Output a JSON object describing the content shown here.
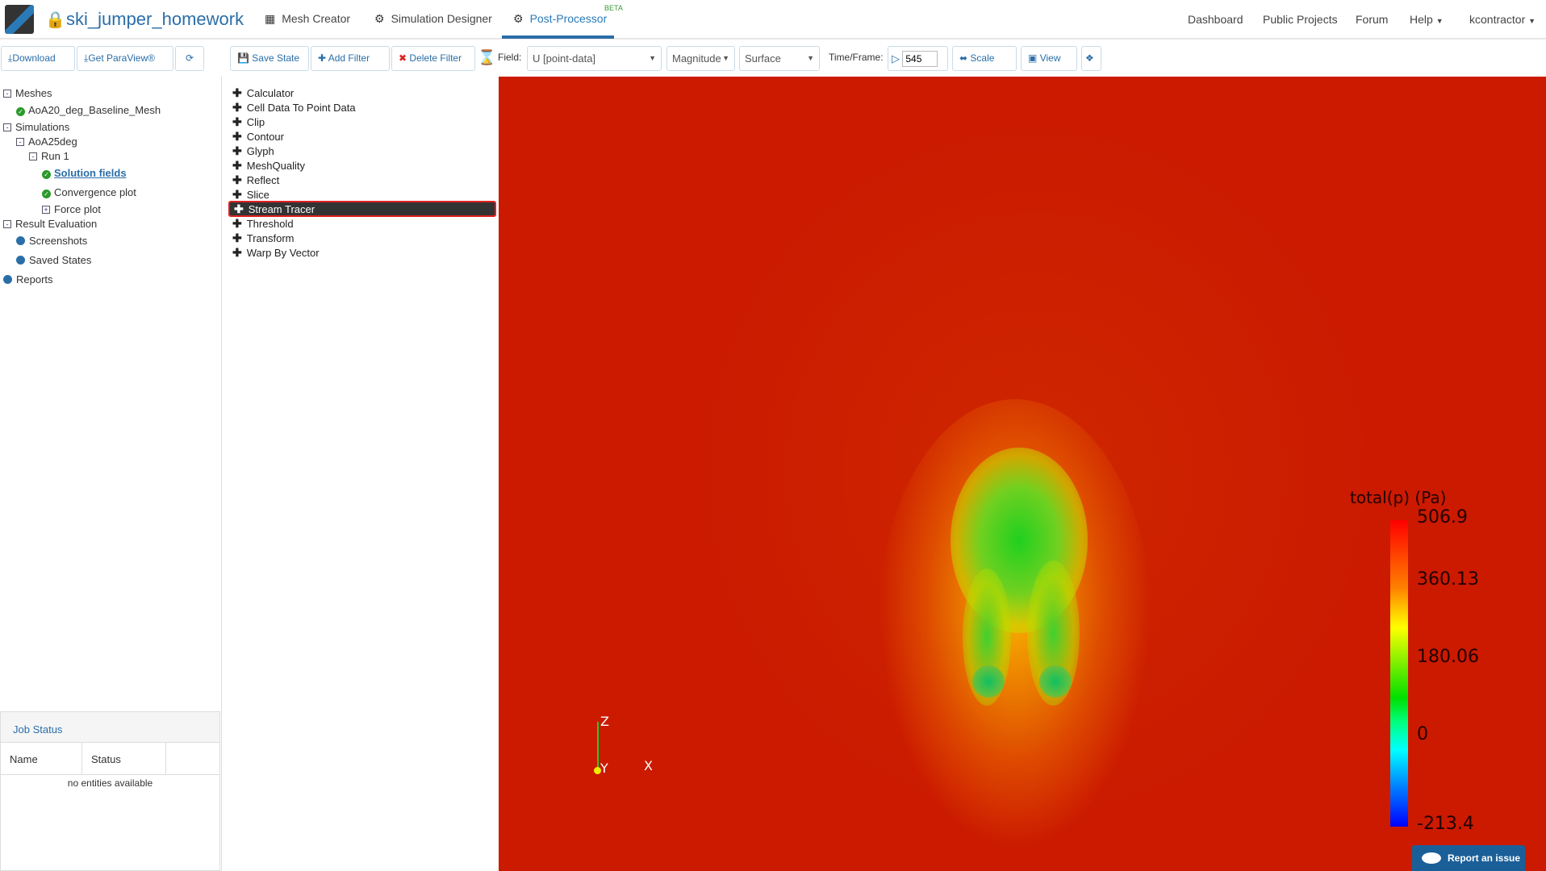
{
  "header": {
    "project_title": "ski_jumper_homework",
    "nav": [
      {
        "label": "Mesh Creator",
        "icon": "grid-icon"
      },
      {
        "label": "Simulation Designer",
        "icon": "gears-icon"
      },
      {
        "label": "Post-Processor",
        "icon": "cog-icon",
        "active": true,
        "badge": "BETA"
      }
    ],
    "right_nav": [
      "Dashboard",
      "Public Projects",
      "Forum",
      "Help",
      "kcontractor"
    ]
  },
  "left_toolbar": {
    "download": "Download",
    "get_paraview": "Get ParaView®",
    "refresh_icon": "refresh-icon"
  },
  "toolbar": {
    "save_state": "Save State",
    "add_filter": "Add Filter",
    "delete_filter": "Delete Filter",
    "field_label": "Field:",
    "field_value": "U [point-data]",
    "component_value": "Magnitude",
    "representation_value": "Surface",
    "time_label": "Time/Frame:",
    "time_value": "545",
    "scale": "Scale",
    "view": "View"
  },
  "tree": {
    "meshes": "Meshes",
    "mesh_item": "AoA20_deg_Baseline_Mesh",
    "simulations": "Simulations",
    "sim": "AoA25deg",
    "run": "Run 1",
    "solution_fields": "Solution fields",
    "convergence_plot": "Convergence plot",
    "force_plot": "Force plot",
    "result_evaluation": "Result Evaluation",
    "screenshots": "Screenshots",
    "saved_states": "Saved States",
    "reports": "Reports"
  },
  "job_status": {
    "title": "Job Status",
    "columns": [
      "Name",
      "Status"
    ],
    "empty": "no entities available"
  },
  "filters": [
    "Calculator",
    "Cell Data To Point Data",
    "Clip",
    "Contour",
    "Glyph",
    "MeshQuality",
    "Reflect",
    "Slice",
    "Stream Tracer",
    "Threshold",
    "Transform",
    "Warp By Vector"
  ],
  "selected_filter": "Stream Tracer",
  "viewport": {
    "colorbar_title": "total(p) (Pa)",
    "colorbar_labels": [
      "506.9",
      "360.13",
      "180.06",
      "0",
      "-213.4"
    ],
    "range": [
      -213.4,
      506.9
    ],
    "axes": {
      "z": "Z",
      "y": "Y",
      "x": "X"
    },
    "background_color": "#cb1a00"
  },
  "report_issue": "Report an issue"
}
